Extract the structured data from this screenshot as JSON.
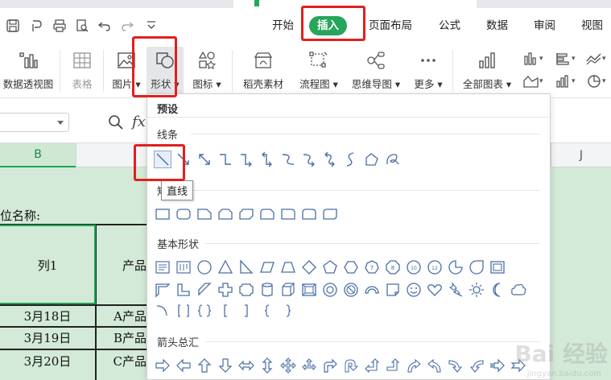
{
  "menu": {
    "tabs": [
      {
        "label": "开始"
      },
      {
        "label": "插入"
      },
      {
        "label": "页面布局"
      },
      {
        "label": "公式"
      },
      {
        "label": "数据"
      },
      {
        "label": "审阅"
      },
      {
        "label": "视图"
      }
    ],
    "active_tab": "插入"
  },
  "ribbon": {
    "pivot_table": "数据透视图",
    "table": "表格",
    "picture": "图片",
    "shape": "形状",
    "icon": "图标",
    "docer_material": "稻壳素材",
    "flowchart": "流程图",
    "mindmap": "思维导图",
    "more": "更多",
    "all_charts": "全部图表"
  },
  "formula_bar": {
    "fx": "fx"
  },
  "columns": {
    "b": "B",
    "j": "J"
  },
  "sheet": {
    "unit_label": "位名称:",
    "header_col1": "列1",
    "header_col2": "产品",
    "rows": [
      {
        "date": "3月18日",
        "product": "A产品"
      },
      {
        "date": "3月19日",
        "product": "B产品"
      },
      {
        "date": "3月20日",
        "product": "C产品"
      }
    ]
  },
  "shapes_panel": {
    "preset": "预设",
    "lines": "线条",
    "rect_partial": "矩",
    "basic_shapes": "基本形状",
    "arrows": "箭头总汇",
    "tooltip": "直线"
  },
  "colors": {
    "accent": "#26a65b",
    "annotation": "#e0201f",
    "shape_stroke": "#4a6fa5",
    "sheet_fill": "#d3ead8"
  },
  "watermark": {
    "text": "Bai 经验",
    "sub": "jingyan.baidu.com"
  }
}
